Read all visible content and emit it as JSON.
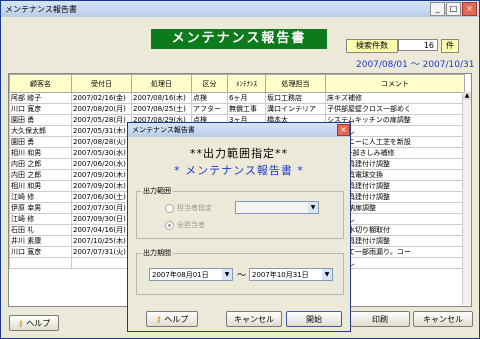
{
  "window": {
    "title": "メンテナンス報告書"
  },
  "header": {
    "title": "メンテナンス報告書",
    "count_label": "検索件数",
    "count_value": "16",
    "count_unit": "件",
    "period": "2007/08/01 ～ 2007/10/31"
  },
  "table": {
    "columns": [
      "顧客名",
      "受付日",
      "処理日",
      "区分",
      "ﾒﾝﾃﾅﾝｽ",
      "処理担当",
      "コメント"
    ],
    "rows": [
      [
        "阿部 綾子",
        "2007/02/16(金)",
        "2007/08/16(木)",
        "点検",
        "6ヶ月",
        "坂口工務店",
        "床キズ補修"
      ],
      [
        "川口 寛彦",
        "2007/08/20(月)",
        "2007/08/25(土)",
        "アフター",
        "無償工事",
        "溝口インテリア",
        "子供部屋壁クロス一部めく"
      ],
      [
        "園田 勇",
        "2007/05/28(月)",
        "2007/08/29(水)",
        "点検",
        "3ヶ月",
        "橋本太",
        "システムキッチンの扉調整"
      ],
      [
        "大久保太郎",
        "2007/05/31(木)",
        "",
        "",
        "",
        "",
        "異常なし"
      ],
      [
        "園田 勇",
        "2007/08/28(火)",
        "",
        "",
        "",
        "",
        "バルコニーに人工芝を新設"
      ],
      [
        "相川 和男",
        "2007/05/30(水)",
        "",
        "",
        "",
        "",
        "1階床一部きしみ補修"
      ],
      [
        "内田 之郎",
        "2007/06/20(水)",
        "",
        "",
        "",
        "",
        "木製建具建付け調整"
      ],
      [
        "内田 之郎",
        "2007/09/20(木)",
        "",
        "",
        "",
        "",
        "照明器具電球交換"
      ],
      [
        "相川 和男",
        "2007/09/20(木)",
        "",
        "",
        "",
        "",
        "木製建具建付け調整"
      ],
      [
        "江崎 修",
        "2007/06/30(土)",
        "",
        "",
        "",
        "",
        "木製建具建付け調整"
      ],
      [
        "伊原 幸男",
        "2007/07/30(月)",
        "",
        "",
        "",
        "",
        "玄関収納扉調整"
      ],
      [
        "江崎 修",
        "2007/09/30(日)",
        "",
        "",
        "",
        "",
        "異常なし"
      ],
      [
        "石田 礼",
        "2007/04/16(月)",
        "",
        "",
        "",
        "",
        "流し台水切り棚取付"
      ],
      [
        "井川 素康",
        "2007/10/25(木)",
        "",
        "",
        "",
        "",
        "木製建具建付け調整"
      ],
      [
        "川口 寛彦",
        "2007/07/31(火)",
        "",
        "",
        "",
        "",
        "台風にて一部雨漏り。コー"
      ],
      [
        "",
        "",
        "",
        "",
        "",
        "",
        "異常なし"
      ]
    ]
  },
  "buttons": {
    "help": "ヘルプ",
    "print": "印刷",
    "cancel": "キャンセル"
  },
  "dialog": {
    "title": "メンテナンス報告書",
    "heading1": "**出力範囲指定**",
    "heading2": "* メンテナンス報告書 *",
    "range_group": "出力範囲",
    "radio_staff": "担当者指定",
    "radio_all": "全担当者",
    "period_group": "出力期間",
    "date_from": "2007年08月01日",
    "tilde": "～",
    "date_to": "2007年10月31日",
    "help": "ヘルプ",
    "cancel": "キャンセル",
    "start": "開始"
  }
}
